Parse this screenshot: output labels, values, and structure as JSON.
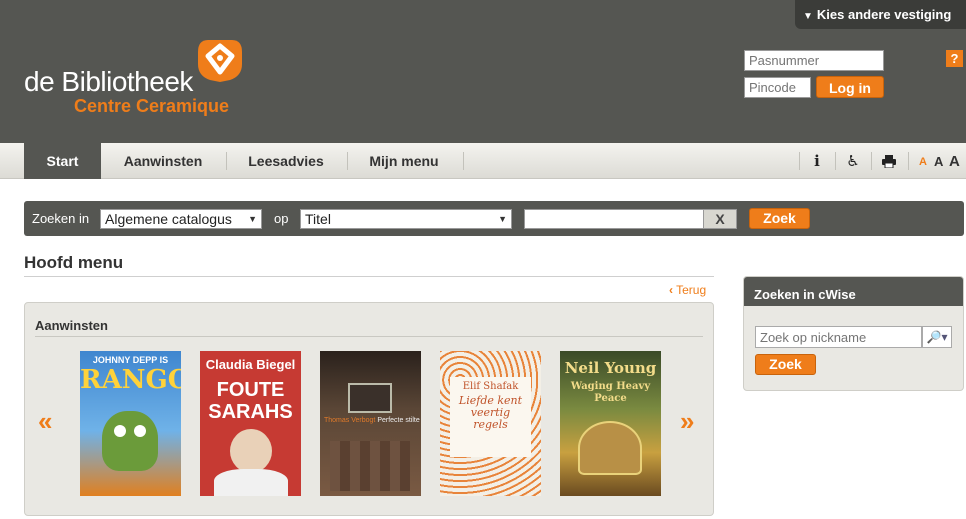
{
  "header": {
    "branch_button": "Kies andere vestiging",
    "logo_main": "de Bibliotheek",
    "logo_sub": "Centre Ceramique",
    "login": {
      "card_placeholder": "Pasnummer",
      "pin_placeholder": "Pincode",
      "login_label": "Log in",
      "help_label": "?"
    }
  },
  "nav": {
    "items": [
      {
        "label": "Start",
        "active": true
      },
      {
        "label": "Aanwinsten",
        "active": false
      },
      {
        "label": "Leesadvies",
        "active": false
      },
      {
        "label": "Mijn menu",
        "active": false
      }
    ],
    "tools": {
      "info": "i",
      "accessibility": "♿",
      "print": "🖶",
      "font_small": "A",
      "font_medium": "A",
      "font_large": "A"
    }
  },
  "search": {
    "in_label": "Zoeken in",
    "catalog_value": "Algemene catalogus",
    "op_label": "op",
    "field_value": "Titel",
    "clear_label": "X",
    "button_label": "Zoek"
  },
  "main": {
    "title": "Hoofd menu",
    "back_label": "Terug",
    "panel": {
      "title": "Aanwinsten",
      "prev": "«",
      "next": "»",
      "books": [
        {
          "top_text": "JOHNNY DEPP IS",
          "title": "RANGO",
          "bg": "#4a8fd0"
        },
        {
          "top_text": "Claudia Biegel",
          "title": "FOUTE SARAHS",
          "bg": "#c73a33"
        },
        {
          "top_text": "Thomas Verbogt",
          "title": "Perfecte stilte",
          "bg": "#4a3a30"
        },
        {
          "top_text": "Elif Shafak",
          "title": "Liefde kent veertig regels",
          "bg": "#f2f0ea"
        },
        {
          "top_text": "Neil Young",
          "title": "Waging Heavy Peace",
          "bg": "#6a8a4c"
        }
      ]
    }
  },
  "side": {
    "title": "Zoeken in cWise",
    "nick_placeholder": "Zoek op nickname",
    "button_label": "Zoek"
  },
  "colors": {
    "brand_orange": "#ef7d1a",
    "header_grey": "#555652",
    "panel_bg": "#e9e8e3"
  }
}
